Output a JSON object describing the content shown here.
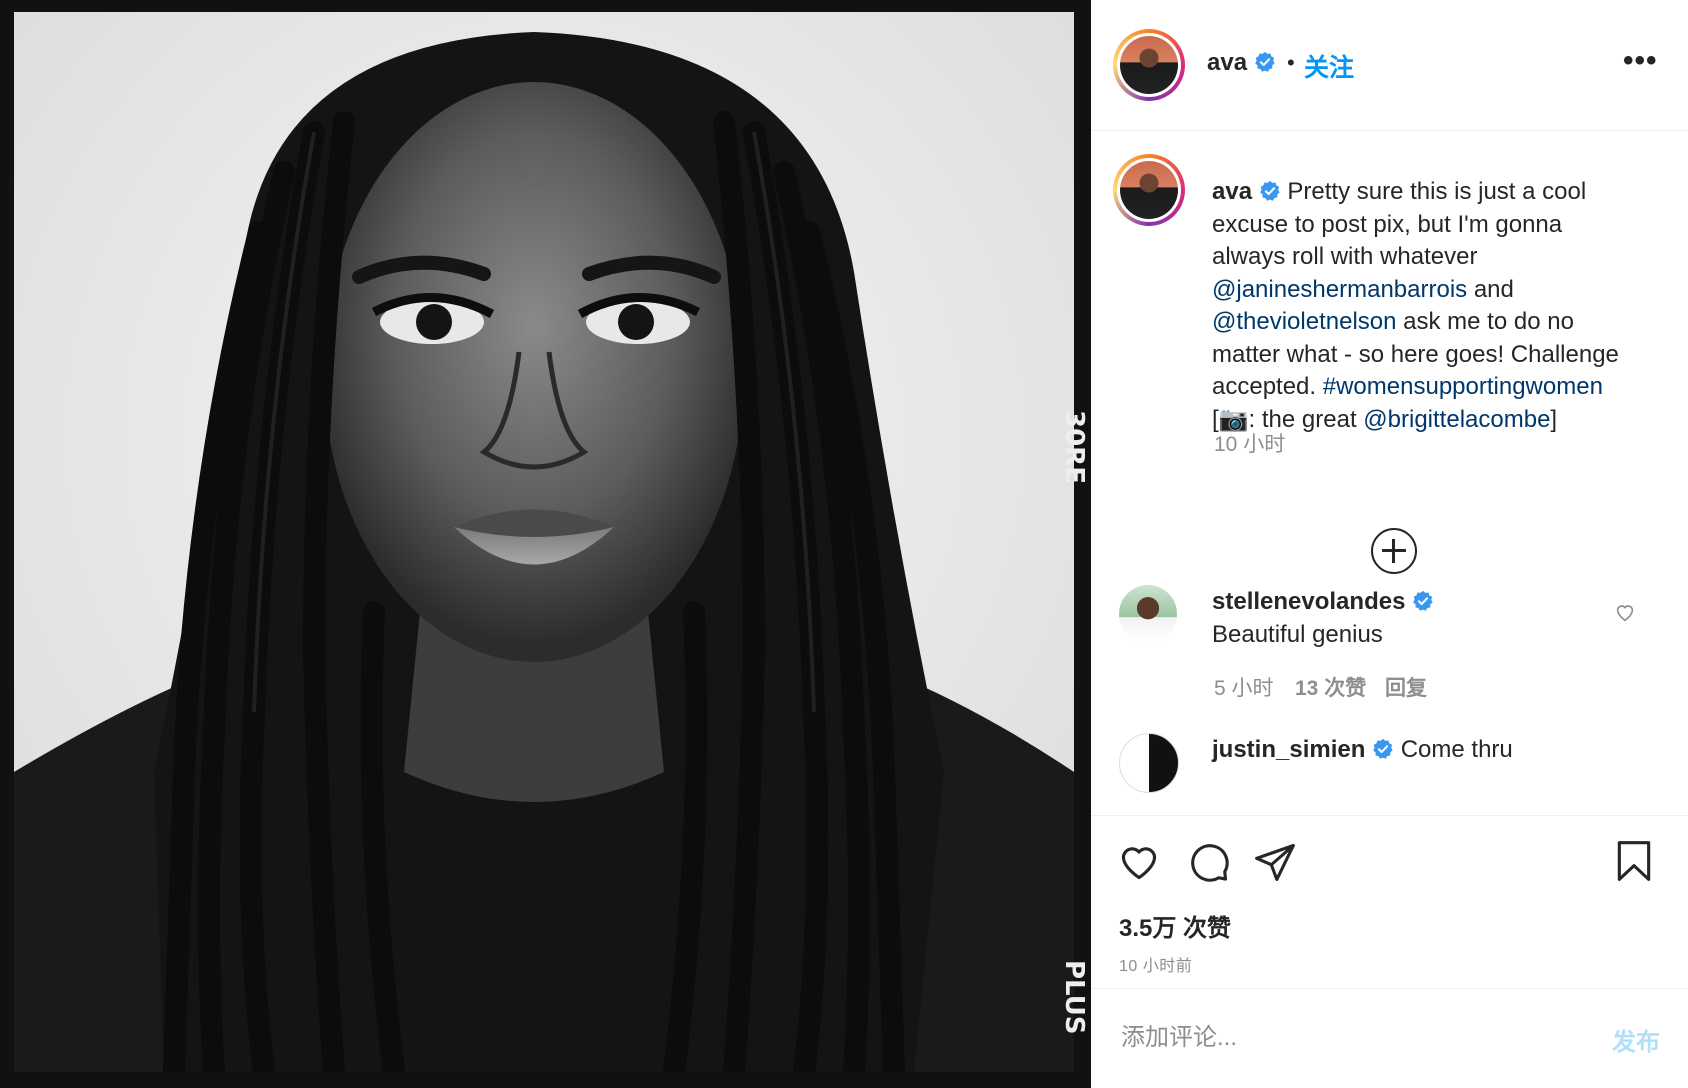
{
  "header": {
    "username": "ava",
    "dot": "•",
    "follow_label": "关注",
    "more_label": "•••"
  },
  "caption": {
    "username": "ava",
    "text_1": "Pretty sure this is just a cool excuse to post pix, but I'm gonna always roll with whatever ",
    "mention_1": "@janineshermanbarrois",
    "text_2": " and ",
    "mention_2": "@thevioletnelson",
    "text_3": " ask me to do no matter what - so here goes! Challenge accepted. ",
    "hashtag": "#womensupportingwomen",
    "text_4": " [📷: the great ",
    "mention_3": "@brigittelacombe",
    "text_5": "]",
    "time": "10 小时"
  },
  "comments": [
    {
      "username": "stellenevolandes",
      "text": "Beautiful genius",
      "time": "5 小时",
      "likes": "13 次赞",
      "reply": "回复"
    },
    {
      "username": "justin_simien",
      "text": "Come thru"
    }
  ],
  "actions": {
    "likes": "3.5万 次赞",
    "time_ago": "10 小时前"
  },
  "add_comment": {
    "placeholder": "添加评论...",
    "post_label": "发布"
  },
  "photo": {
    "edge_text_top": "30RE",
    "edge_text_bottom": "PLUS"
  },
  "colors": {
    "link_blue": "#0095f6",
    "mention_blue": "#00376b",
    "verified_blue": "#3897f0",
    "muted": "#8e8e8e"
  }
}
